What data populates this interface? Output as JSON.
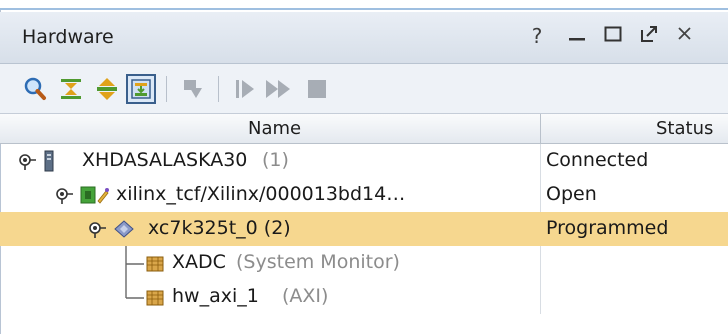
{
  "window": {
    "title": "Hardware",
    "help": "?",
    "minimize": "—",
    "maximize": "☐",
    "float": "↗",
    "close": "×"
  },
  "toolbar": {
    "icons": [
      "search-icon",
      "collapse-all-icon",
      "expand-all-icon",
      "auto-connect-icon",
      "program-device-icon",
      "run-trigger-icon",
      "run-trigger-immediate-icon",
      "stop-trigger-icon"
    ],
    "active": "auto-connect-icon"
  },
  "columns": [
    "Name",
    "Status"
  ],
  "rows": [
    {
      "name": "XHDASALASKA30",
      "suffix": "(1)",
      "status": "Connected"
    },
    {
      "name": "xilinx_tcf/Xilinx/000013bd14…",
      "suffix": "",
      "status": "Open"
    },
    {
      "name": "xc7k325t_0 (2)",
      "suffix": "",
      "status": "Programmed"
    },
    {
      "name": "XADC",
      "suffix": "(System Monitor)",
      "status": ""
    },
    {
      "name": "hw_axi_1",
      "suffix": "(AXI)",
      "status": ""
    }
  ],
  "colors": {
    "selected_row": "#f6d78f",
    "accent": "#3a5f8c"
  }
}
